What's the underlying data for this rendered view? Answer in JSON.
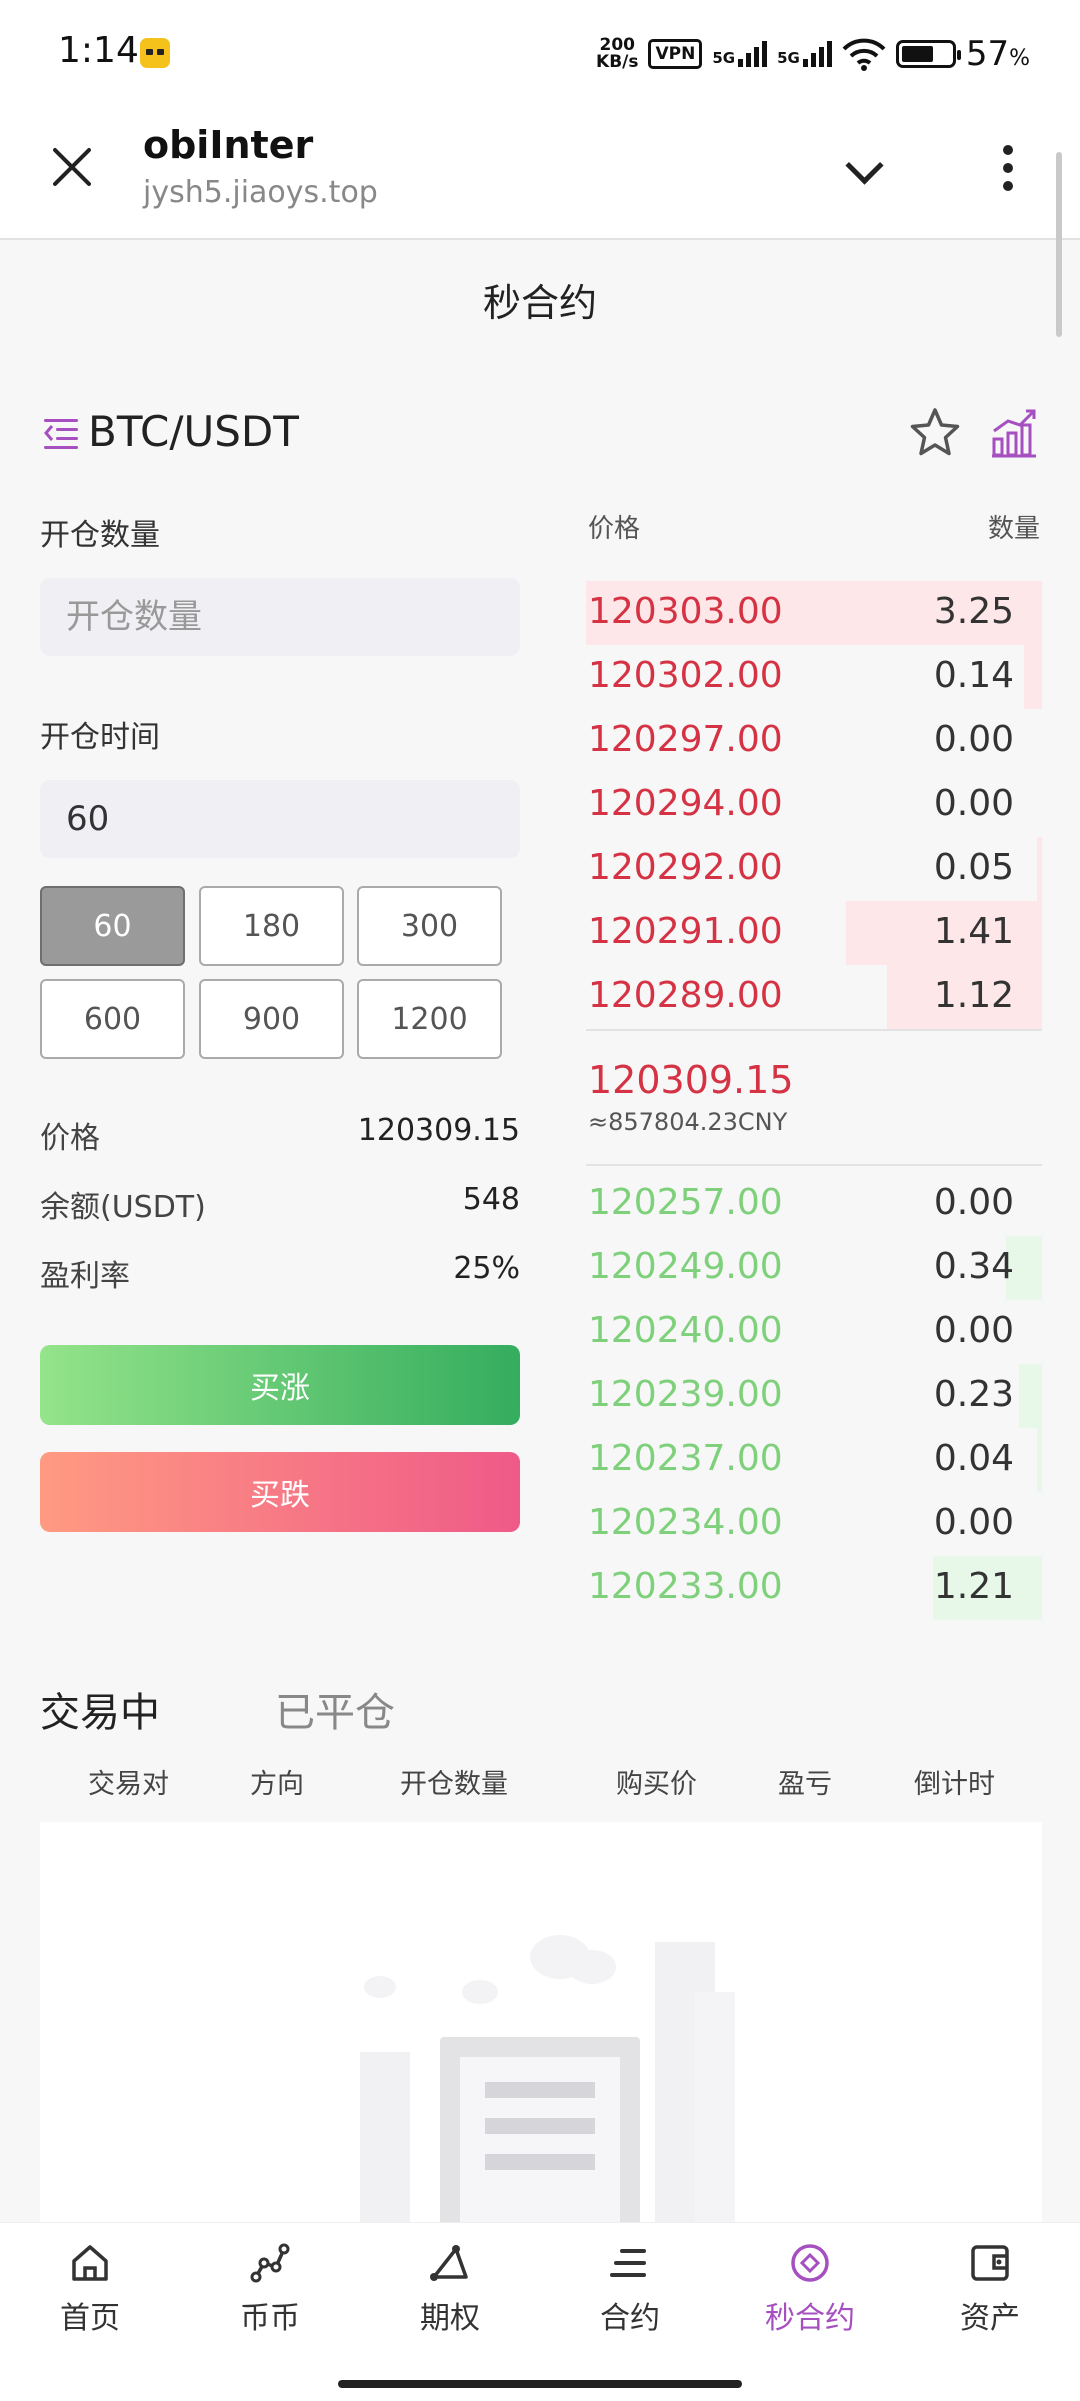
{
  "status_bar": {
    "time": "1:14",
    "speed_value": "200",
    "speed_unit": "KB/s",
    "vpn": "VPN",
    "net1": "5G",
    "net2": "5G",
    "battery": "57",
    "battery_unit": "%"
  },
  "browser": {
    "title": "obiInter",
    "url": "jysh5.jiaoys.top"
  },
  "page": {
    "title": "秒合约",
    "pair": "BTC/USDT",
    "accent": "#a64fc0"
  },
  "form": {
    "qty_label": "开仓数量",
    "qty_placeholder": "开仓数量",
    "time_label": "开仓时间",
    "time_value": "60",
    "time_options": [
      "60",
      "180",
      "300",
      "600",
      "900",
      "1200"
    ],
    "price_label": "价格",
    "price_value": "120309.15",
    "balance_label": "余额(USDT)",
    "balance_value": "548",
    "profit_label": "盈利率",
    "profit_value": "25%",
    "buy_up": "买涨",
    "buy_down": "买跌"
  },
  "orderbook": {
    "price_header": "价格",
    "qty_header": "数量",
    "asks": [
      {
        "price": "120303.00",
        "qty": "3.25",
        "depth": 1.0
      },
      {
        "price": "120302.00",
        "qty": "0.14",
        "depth": 0.04
      },
      {
        "price": "120297.00",
        "qty": "0.00",
        "depth": 0
      },
      {
        "price": "120294.00",
        "qty": "0.00",
        "depth": 0
      },
      {
        "price": "120292.00",
        "qty": "0.05",
        "depth": 0.01
      },
      {
        "price": "120291.00",
        "qty": "1.41",
        "depth": 0.43
      },
      {
        "price": "120289.00",
        "qty": "1.12",
        "depth": 0.34
      }
    ],
    "mid_price": "120309.15",
    "mid_cny": "≈857804.23CNY",
    "bids": [
      {
        "price": "120257.00",
        "qty": "0.00",
        "depth": 0
      },
      {
        "price": "120249.00",
        "qty": "0.34",
        "depth": 0.08
      },
      {
        "price": "120240.00",
        "qty": "0.00",
        "depth": 0
      },
      {
        "price": "120239.00",
        "qty": "0.23",
        "depth": 0.05
      },
      {
        "price": "120237.00",
        "qty": "0.04",
        "depth": 0.01
      },
      {
        "price": "120234.00",
        "qty": "0.00",
        "depth": 0
      },
      {
        "price": "120233.00",
        "qty": "1.21",
        "depth": 0.24
      }
    ]
  },
  "trades": {
    "tab_active": "交易中",
    "tab_closed": "已平仓",
    "columns": [
      "交易对",
      "方向",
      "开仓数量",
      "购买价",
      "盈亏",
      "倒计时"
    ]
  },
  "nav": {
    "items": [
      {
        "label": "首页",
        "icon": "home-icon"
      },
      {
        "label": "币币",
        "icon": "coin-icon"
      },
      {
        "label": "期权",
        "icon": "options-icon"
      },
      {
        "label": "合约",
        "icon": "contract-icon"
      },
      {
        "label": "秒合约",
        "icon": "second-contract-icon"
      },
      {
        "label": "资产",
        "icon": "wallet-icon"
      }
    ],
    "active_index": 4
  }
}
